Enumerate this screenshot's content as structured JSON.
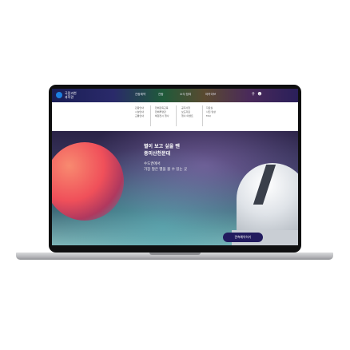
{
  "logo": {
    "text": "국립과천\n과학관"
  },
  "nav": {
    "menu": [
      "관람예약",
      "관람",
      "소식·참여",
      "아카이브"
    ],
    "icons": [
      "search-icon",
      "user-icon"
    ]
  },
  "dropdown": {
    "columns": [
      [
        "관람안내",
        "시설안내",
        "교통안내"
      ],
      [
        "천체관측교육",
        "천체투영관",
        "체험전시 행사"
      ],
      [
        "공지사항",
        "보도자료",
        "행사·이벤트"
      ],
      [
        "자료실",
        "사진·영상",
        "FAQ"
      ]
    ]
  },
  "hero": {
    "title_line1": "별이 보고 싶을 땐",
    "title_line2": "중미산천문대",
    "sub_line1": "수도권에서",
    "sub_line2": "가장 많은 별을 볼 수 있는 곳",
    "button_label": "관측예약하기"
  },
  "colors": {
    "accent": "#221b5e",
    "planet": "#f0505a"
  }
}
